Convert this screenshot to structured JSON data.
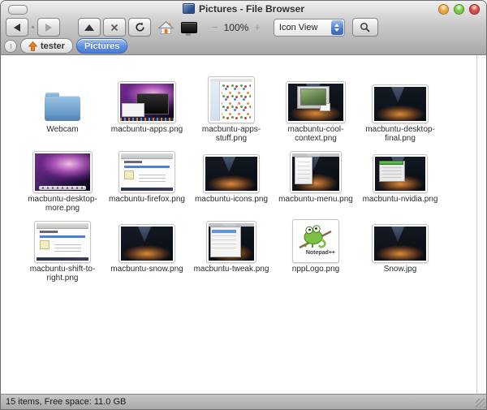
{
  "window": {
    "title": "Pictures - File Browser",
    "icon": "file-browser-app-icon",
    "controls": [
      "toolbar-toggle",
      "minimize",
      "maximize",
      "close"
    ]
  },
  "toolbar": {
    "back": {
      "icon": "back-arrow-icon",
      "enabled": true
    },
    "forward": {
      "icon": "forward-arrow-icon",
      "enabled": false
    },
    "up": {
      "icon": "up-arrow-icon"
    },
    "stop": {
      "icon": "x-icon"
    },
    "reload": {
      "icon": "refresh-icon"
    },
    "home": {
      "icon": "home-house-icon"
    },
    "desktop": {
      "icon": "desktop-monitor-icon"
    },
    "zoom_out_label": "−",
    "zoom_level": "100%",
    "zoom_in_label": "+",
    "view_mode": "Icon View",
    "search": {
      "icon": "magnifier-icon"
    }
  },
  "pathbar": {
    "home_crumb": {
      "label": "tester",
      "icon": "home-up-arrow-icon"
    },
    "current_crumb": {
      "label": "Pictures",
      "selected": true
    }
  },
  "files": [
    {
      "name": "Webcam",
      "type": "folder",
      "thumbnail": "blue-folder"
    },
    {
      "name": "macbuntu-apps.png",
      "type": "image",
      "thumbnail": "purple-galaxy-desktop-with-dark-and-white-windows"
    },
    {
      "name": "macbuntu-apps-stuff.png",
      "type": "image",
      "thumbnail": "file-manager-window-with-icon-grid"
    },
    {
      "name": "macbuntu-cool-context.png",
      "type": "image",
      "thumbnail": "night-mountain-desktop-with-photo-window"
    },
    {
      "name": "macbuntu-desktop-final.png",
      "type": "image",
      "thumbnail": "night-mountain-desktop"
    },
    {
      "name": "macbuntu-desktop-more.png",
      "type": "image",
      "thumbnail": "purple-galaxy-desktop-with-dock"
    },
    {
      "name": "macbuntu-firefox.png",
      "type": "image",
      "thumbnail": "browser-page-dedomedo"
    },
    {
      "name": "macbuntu-icons.png",
      "type": "image",
      "thumbnail": "night-mountain-desktop"
    },
    {
      "name": "macbuntu-menu.png",
      "type": "image",
      "thumbnail": "night-mountain-desktop-with-open-menu"
    },
    {
      "name": "macbuntu-nvidia.png",
      "type": "image",
      "thumbnail": "night-mountain-desktop-with-nvidia-window"
    },
    {
      "name": "macbuntu-shift-to-right.png",
      "type": "image",
      "thumbnail": "browser-page-dedomedo"
    },
    {
      "name": "macbuntu-snow.png",
      "type": "image",
      "thumbnail": "night-mountain-desktop"
    },
    {
      "name": "macbuntu-tweak.png",
      "type": "image",
      "thumbnail": "settings-window-over-mountain-desktop"
    },
    {
      "name": "nppLogo.png",
      "type": "image",
      "thumbnail": "notepad-plus-plus-chameleon-logo",
      "logo_text": "Notepad++"
    },
    {
      "name": "Snow.jpg",
      "type": "image",
      "thumbnail": "night-mountain-desktop"
    }
  ],
  "statusbar": {
    "text": "15 items, Free space: 11.0 GB"
  },
  "colors": {
    "selection_blue": "#4a7cd0",
    "chrome_top": "#efefef",
    "chrome_bottom": "#a8a8a8",
    "traffic_orange": "#eda33c",
    "traffic_green": "#74cb45",
    "traffic_red": "#d84a45",
    "folder_blue": "#6498c6"
  }
}
